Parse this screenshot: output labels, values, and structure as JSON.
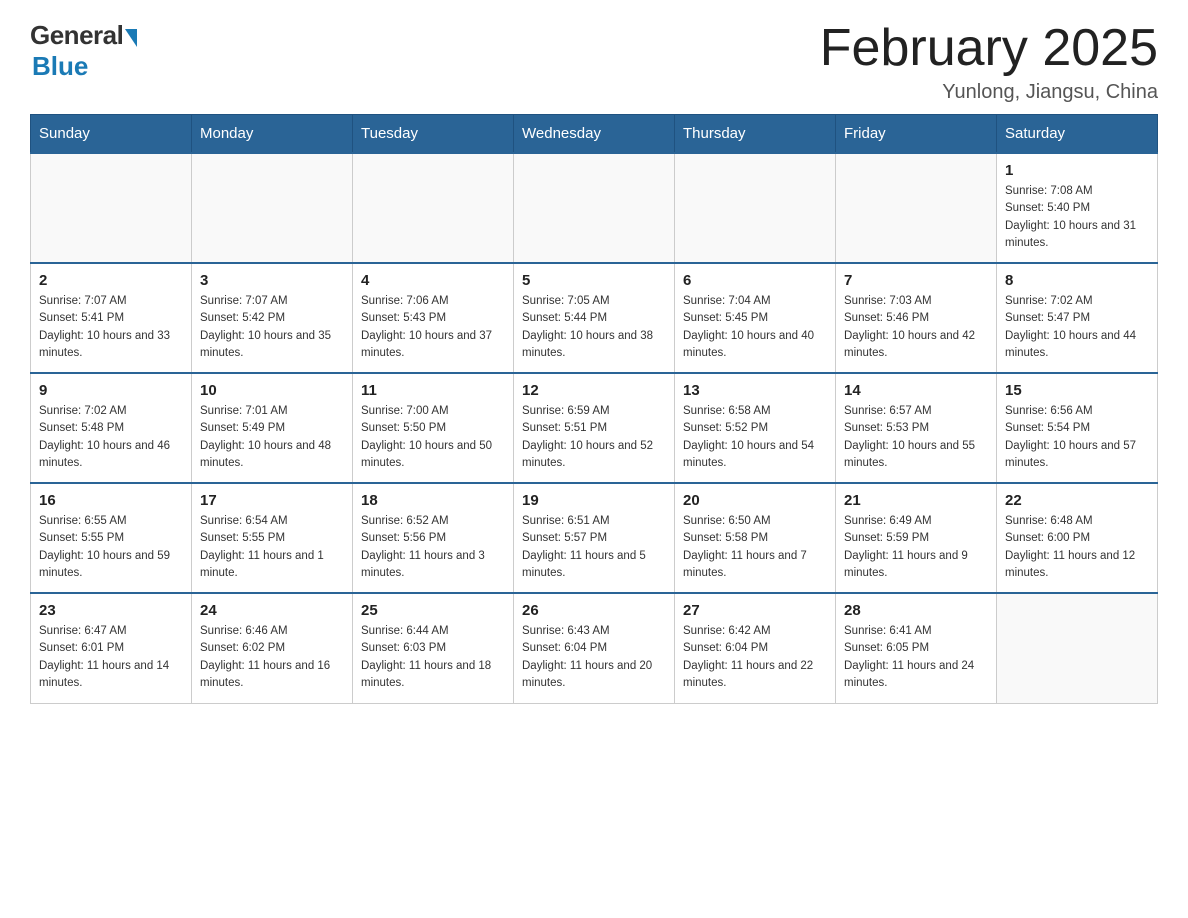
{
  "header": {
    "logo_general": "General",
    "logo_blue": "Blue",
    "title": "February 2025",
    "location": "Yunlong, Jiangsu, China"
  },
  "days_of_week": [
    "Sunday",
    "Monday",
    "Tuesday",
    "Wednesday",
    "Thursday",
    "Friday",
    "Saturday"
  ],
  "weeks": [
    [
      {
        "day": "",
        "info": ""
      },
      {
        "day": "",
        "info": ""
      },
      {
        "day": "",
        "info": ""
      },
      {
        "day": "",
        "info": ""
      },
      {
        "day": "",
        "info": ""
      },
      {
        "day": "",
        "info": ""
      },
      {
        "day": "1",
        "info": "Sunrise: 7:08 AM\nSunset: 5:40 PM\nDaylight: 10 hours and 31 minutes."
      }
    ],
    [
      {
        "day": "2",
        "info": "Sunrise: 7:07 AM\nSunset: 5:41 PM\nDaylight: 10 hours and 33 minutes."
      },
      {
        "day": "3",
        "info": "Sunrise: 7:07 AM\nSunset: 5:42 PM\nDaylight: 10 hours and 35 minutes."
      },
      {
        "day": "4",
        "info": "Sunrise: 7:06 AM\nSunset: 5:43 PM\nDaylight: 10 hours and 37 minutes."
      },
      {
        "day": "5",
        "info": "Sunrise: 7:05 AM\nSunset: 5:44 PM\nDaylight: 10 hours and 38 minutes."
      },
      {
        "day": "6",
        "info": "Sunrise: 7:04 AM\nSunset: 5:45 PM\nDaylight: 10 hours and 40 minutes."
      },
      {
        "day": "7",
        "info": "Sunrise: 7:03 AM\nSunset: 5:46 PM\nDaylight: 10 hours and 42 minutes."
      },
      {
        "day": "8",
        "info": "Sunrise: 7:02 AM\nSunset: 5:47 PM\nDaylight: 10 hours and 44 minutes."
      }
    ],
    [
      {
        "day": "9",
        "info": "Sunrise: 7:02 AM\nSunset: 5:48 PM\nDaylight: 10 hours and 46 minutes."
      },
      {
        "day": "10",
        "info": "Sunrise: 7:01 AM\nSunset: 5:49 PM\nDaylight: 10 hours and 48 minutes."
      },
      {
        "day": "11",
        "info": "Sunrise: 7:00 AM\nSunset: 5:50 PM\nDaylight: 10 hours and 50 minutes."
      },
      {
        "day": "12",
        "info": "Sunrise: 6:59 AM\nSunset: 5:51 PM\nDaylight: 10 hours and 52 minutes."
      },
      {
        "day": "13",
        "info": "Sunrise: 6:58 AM\nSunset: 5:52 PM\nDaylight: 10 hours and 54 minutes."
      },
      {
        "day": "14",
        "info": "Sunrise: 6:57 AM\nSunset: 5:53 PM\nDaylight: 10 hours and 55 minutes."
      },
      {
        "day": "15",
        "info": "Sunrise: 6:56 AM\nSunset: 5:54 PM\nDaylight: 10 hours and 57 minutes."
      }
    ],
    [
      {
        "day": "16",
        "info": "Sunrise: 6:55 AM\nSunset: 5:55 PM\nDaylight: 10 hours and 59 minutes."
      },
      {
        "day": "17",
        "info": "Sunrise: 6:54 AM\nSunset: 5:55 PM\nDaylight: 11 hours and 1 minute."
      },
      {
        "day": "18",
        "info": "Sunrise: 6:52 AM\nSunset: 5:56 PM\nDaylight: 11 hours and 3 minutes."
      },
      {
        "day": "19",
        "info": "Sunrise: 6:51 AM\nSunset: 5:57 PM\nDaylight: 11 hours and 5 minutes."
      },
      {
        "day": "20",
        "info": "Sunrise: 6:50 AM\nSunset: 5:58 PM\nDaylight: 11 hours and 7 minutes."
      },
      {
        "day": "21",
        "info": "Sunrise: 6:49 AM\nSunset: 5:59 PM\nDaylight: 11 hours and 9 minutes."
      },
      {
        "day": "22",
        "info": "Sunrise: 6:48 AM\nSunset: 6:00 PM\nDaylight: 11 hours and 12 minutes."
      }
    ],
    [
      {
        "day": "23",
        "info": "Sunrise: 6:47 AM\nSunset: 6:01 PM\nDaylight: 11 hours and 14 minutes."
      },
      {
        "day": "24",
        "info": "Sunrise: 6:46 AM\nSunset: 6:02 PM\nDaylight: 11 hours and 16 minutes."
      },
      {
        "day": "25",
        "info": "Sunrise: 6:44 AM\nSunset: 6:03 PM\nDaylight: 11 hours and 18 minutes."
      },
      {
        "day": "26",
        "info": "Sunrise: 6:43 AM\nSunset: 6:04 PM\nDaylight: 11 hours and 20 minutes."
      },
      {
        "day": "27",
        "info": "Sunrise: 6:42 AM\nSunset: 6:04 PM\nDaylight: 11 hours and 22 minutes."
      },
      {
        "day": "28",
        "info": "Sunrise: 6:41 AM\nSunset: 6:05 PM\nDaylight: 11 hours and 24 minutes."
      },
      {
        "day": "",
        "info": ""
      }
    ]
  ]
}
